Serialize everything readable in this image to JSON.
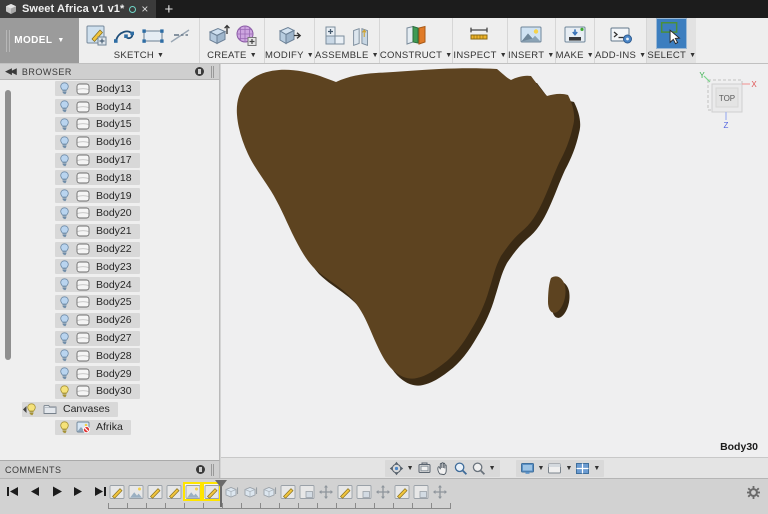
{
  "window": {
    "tab": {
      "title": "Sweet Africa v1 v1*",
      "app_icon": "cube-icon",
      "save_indicator": "circle-icon",
      "close": "×",
      "new_tab": "+"
    }
  },
  "ribbon": {
    "workspace": {
      "label": "MODEL",
      "caret": "▼"
    },
    "groups": [
      {
        "label": "SKETCH",
        "caret": "▼",
        "icons": [
          "create-sketch-icon",
          "spline-icon",
          "rectangle-icon",
          "dimension-icon"
        ]
      },
      {
        "label": "CREATE",
        "caret": "▼",
        "icons": [
          "extrude-icon",
          "mesh-icon"
        ]
      },
      {
        "label": "MODIFY",
        "caret": "▼",
        "icons": [
          "press-pull-icon"
        ]
      },
      {
        "label": "ASSEMBLE",
        "caret": "▼",
        "icons": [
          "new-component-icon",
          "joint-icon"
        ]
      },
      {
        "label": "CONSTRUCT",
        "caret": "▼",
        "icons": [
          "offset-plane-icon"
        ]
      },
      {
        "label": "INSPECT",
        "caret": "▼",
        "icons": [
          "measure-icon"
        ]
      },
      {
        "label": "INSERT",
        "caret": "▼",
        "icons": [
          "insert-canvas-icon"
        ]
      },
      {
        "label": "MAKE",
        "caret": "▼",
        "icons": [
          "3d-print-icon"
        ]
      },
      {
        "label": "ADD-INS",
        "caret": "▼",
        "icons": [
          "scripts-addins-icon"
        ]
      },
      {
        "label": "SELECT",
        "caret": "▼",
        "icons": [
          "select-tool-icon"
        ],
        "active": true
      }
    ]
  },
  "browser": {
    "header": {
      "title": "BROWSER",
      "collapse_icon": "collapse-left-icon",
      "options_icon": "panel-options-icon"
    },
    "items": [
      {
        "label": "Body13",
        "type": "body",
        "light": "off"
      },
      {
        "label": "Body14",
        "type": "body",
        "light": "off"
      },
      {
        "label": "Body15",
        "type": "body",
        "light": "off"
      },
      {
        "label": "Body16",
        "type": "body",
        "light": "off"
      },
      {
        "label": "Body17",
        "type": "body",
        "light": "off"
      },
      {
        "label": "Body18",
        "type": "body",
        "light": "off"
      },
      {
        "label": "Body19",
        "type": "body",
        "light": "off"
      },
      {
        "label": "Body20",
        "type": "body",
        "light": "off"
      },
      {
        "label": "Body21",
        "type": "body",
        "light": "off"
      },
      {
        "label": "Body22",
        "type": "body",
        "light": "off"
      },
      {
        "label": "Body23",
        "type": "body",
        "light": "off"
      },
      {
        "label": "Body24",
        "type": "body",
        "light": "off"
      },
      {
        "label": "Body25",
        "type": "body",
        "light": "off"
      },
      {
        "label": "Body26",
        "type": "body",
        "light": "off"
      },
      {
        "label": "Body27",
        "type": "body",
        "light": "off"
      },
      {
        "label": "Body28",
        "type": "body",
        "light": "off"
      },
      {
        "label": "Body29",
        "type": "body",
        "light": "off"
      },
      {
        "label": "Body30",
        "type": "body",
        "light": "on"
      },
      {
        "label": "Canvases",
        "type": "folder",
        "light": "on",
        "expanded": true
      },
      {
        "label": "Afrika",
        "type": "canvas",
        "light": "on"
      }
    ]
  },
  "comments": {
    "title": "COMMENTS",
    "options_icon": "panel-options-icon"
  },
  "canvas": {
    "model_name": "Body30",
    "model_color": "#5d4320",
    "model_edge_color": "#3a2a14",
    "background": "#efeff0",
    "viewcube": {
      "face_label": "TOP",
      "axes": [
        {
          "label": "Y",
          "color": "#22aa44"
        },
        {
          "label": "X",
          "color": "#dd3333"
        },
        {
          "label": "Z",
          "color": "#3355dd"
        }
      ]
    }
  },
  "navbar": {
    "groups": [
      {
        "items": [
          {
            "icon": "orbit-icon",
            "caret": "▼"
          },
          {
            "icon": "look-at-icon",
            "caret": ""
          },
          {
            "icon": "pan-icon",
            "caret": ""
          },
          {
            "icon": "zoom-icon",
            "caret": ""
          },
          {
            "icon": "zoom-window-icon",
            "caret": "▼"
          }
        ]
      },
      {
        "items": [
          {
            "icon": "display-settings-icon",
            "caret": "▼"
          },
          {
            "icon": "grid-snap-icon",
            "caret": "▼"
          },
          {
            "icon": "viewports-icon",
            "caret": "▼"
          }
        ]
      }
    ]
  },
  "timeline": {
    "playback": [
      "skip-start-icon",
      "step-back-icon",
      "play-icon",
      "step-forward-icon",
      "skip-end-icon"
    ],
    "features": [
      {
        "icon": "sketch-feature-icon",
        "highlighted": false
      },
      {
        "icon": "canvas-feature-icon",
        "highlighted": false
      },
      {
        "icon": "sketch-feature-icon",
        "highlighted": false
      },
      {
        "icon": "sketch-feature-icon",
        "highlighted": false
      },
      {
        "icon": "canvas-feature-icon",
        "highlighted": true
      },
      {
        "icon": "sketch-feature-icon",
        "highlighted": true
      },
      {
        "icon": "extrude-feature-icon",
        "highlighted": false
      },
      {
        "icon": "extrude-feature-icon",
        "highlighted": false
      },
      {
        "icon": "extrude-feature-icon",
        "highlighted": false
      },
      {
        "icon": "sketch-feature-icon",
        "highlighted": false
      },
      {
        "icon": "shell-feature-icon",
        "highlighted": false
      },
      {
        "icon": "move-feature-icon",
        "highlighted": false
      },
      {
        "icon": "sketch-feature-icon",
        "highlighted": false
      },
      {
        "icon": "shell-feature-icon",
        "highlighted": false
      },
      {
        "icon": "move-feature-icon",
        "highlighted": false
      },
      {
        "icon": "sketch-feature-icon",
        "highlighted": false
      },
      {
        "icon": "shell-feature-icon",
        "highlighted": false
      },
      {
        "icon": "move-feature-icon",
        "highlighted": false
      }
    ],
    "settings_icon": "gear-icon"
  }
}
